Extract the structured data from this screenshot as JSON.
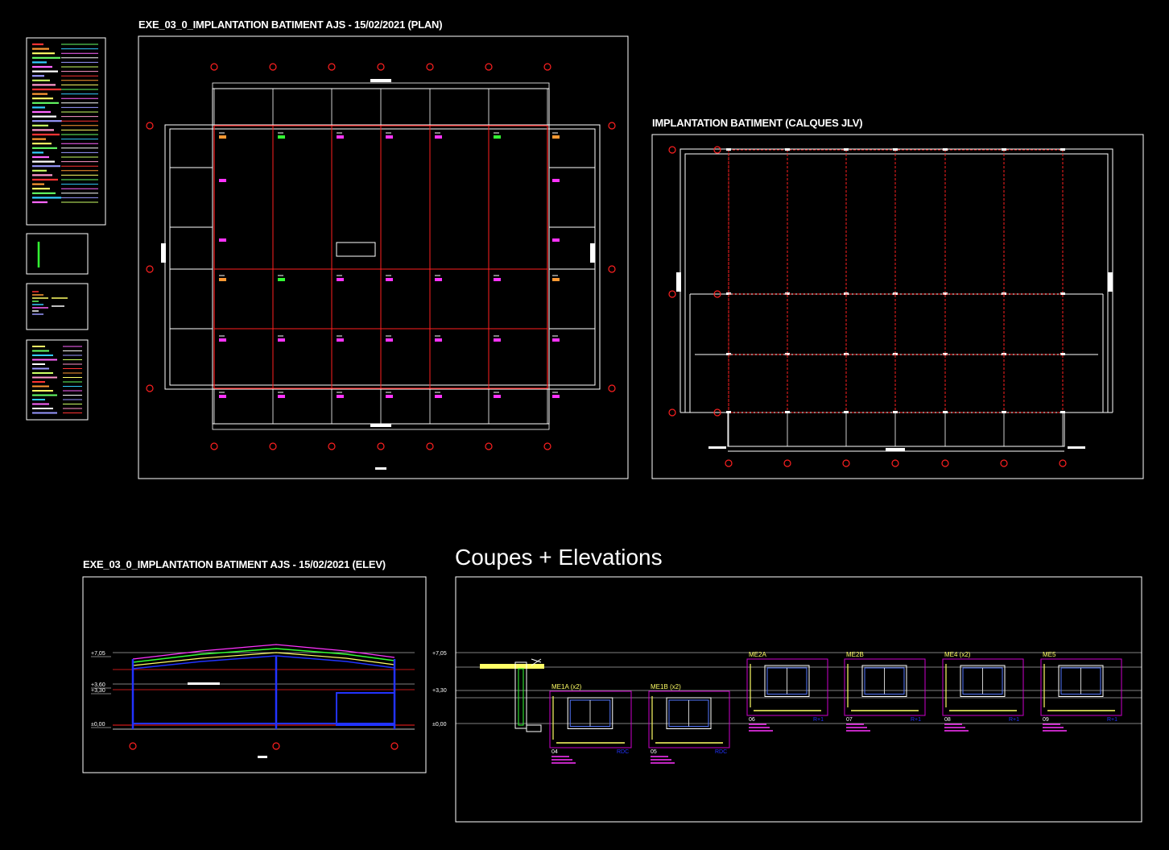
{
  "sheets": {
    "plan_title": "EXE_03_0_IMPLANTATION BATIMENT AJS - 15/02/2021 (PLAN)",
    "calques_title": "IMPLANTATION BATIMENT   (CALQUES JLV)",
    "elev_title": "EXE_03_0_IMPLANTATION BATIMENT AJS - 15/02/2021 (ELEV)",
    "coupes_title": "Coupes + Elevations"
  },
  "elevation_levels": [
    "+7,05",
    "+3,60",
    "+3,30",
    "±0,00"
  ],
  "coupe_levels": [
    "+7,05",
    "+3,30",
    "±0,00"
  ],
  "details": [
    {
      "code": "ME1A (x2)",
      "num": "04",
      "level": "RDC"
    },
    {
      "code": "ME1B (x2)",
      "num": "05",
      "level": "RDC"
    },
    {
      "code": "ME2A",
      "num": "06",
      "level": "R+1"
    },
    {
      "code": "ME2B",
      "num": "07",
      "level": "R+1"
    },
    {
      "code": "ME4 (x2)",
      "num": "08",
      "level": "R+1"
    },
    {
      "code": "ME5",
      "num": "09",
      "level": "R+1"
    }
  ],
  "colors": {
    "background": "#000000",
    "frame": "#ffffff",
    "grid": "#ff2020",
    "detail_frame": "#cc00cc",
    "annot": "#ff33ff",
    "accent_yellow": "#ffff66",
    "accent_blue": "#2233ff",
    "accent_green": "#33ff33"
  }
}
